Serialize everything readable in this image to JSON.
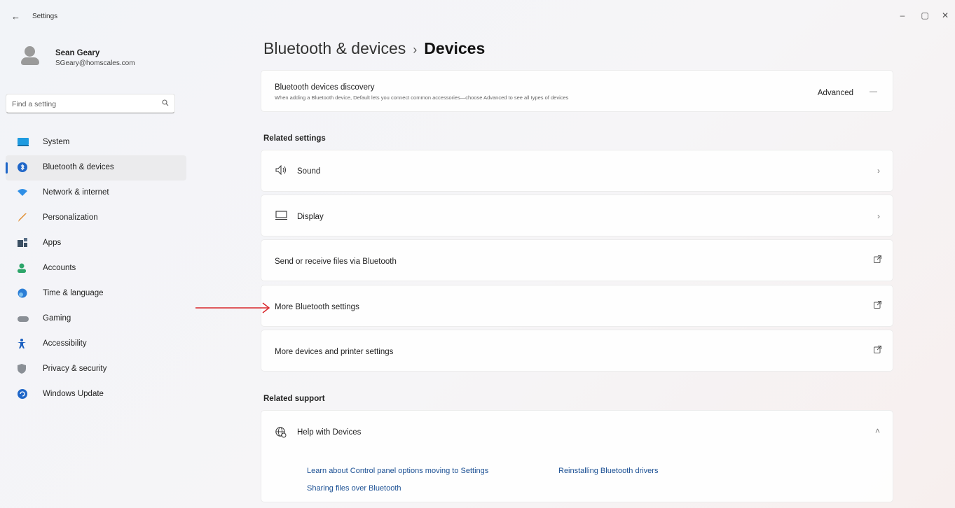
{
  "window": {
    "title": "Settings",
    "back": "←",
    "minimize": "–",
    "maximize": "▢",
    "close": "✕"
  },
  "user": {
    "name": "Sean Geary",
    "email": "SGeary@homscales.com"
  },
  "search": {
    "placeholder": "Find a setting",
    "icon": "search-icon"
  },
  "sidebar": {
    "items": [
      {
        "label": "System",
        "icon": "system-icon",
        "color": "#1f9be0"
      },
      {
        "label": "Bluetooth & devices",
        "icon": "bluetooth-icon",
        "color": "#1f66c8",
        "selected": true
      },
      {
        "label": "Network & internet",
        "icon": "wifi-icon",
        "color": "#2f8fe6"
      },
      {
        "label": "Personalization",
        "icon": "brush-icon",
        "color": "#e08b2c"
      },
      {
        "label": "Apps",
        "icon": "apps-icon",
        "color": "#3b4f63"
      },
      {
        "label": "Accounts",
        "icon": "accounts-icon",
        "color": "#2da56a"
      },
      {
        "label": "Time & language",
        "icon": "globe-clock-icon",
        "color": "#2b7dd6"
      },
      {
        "label": "Gaming",
        "icon": "controller-icon",
        "color": "#8a8f96"
      },
      {
        "label": "Accessibility",
        "icon": "accessibility-icon",
        "color": "#1a5fc0"
      },
      {
        "label": "Privacy & security",
        "icon": "shield-icon",
        "color": "#8a8f96"
      },
      {
        "label": "Windows Update",
        "icon": "update-icon",
        "color": "#1f66c8"
      }
    ]
  },
  "main": {
    "breadcrumb": {
      "parent": "Bluetooth & devices",
      "separator": "›",
      "current": "Devices"
    },
    "discovery": {
      "title": "Bluetooth devices discovery",
      "description": "When adding a Bluetooth device, Default lets you connect common accessories—choose Advanced to see all types of devices",
      "value": "Advanced"
    },
    "related_settings": {
      "title": "Related settings",
      "items": [
        {
          "label": "Sound",
          "icon": "speaker-icon",
          "action": "chevron"
        },
        {
          "label": "Display",
          "icon": "monitor-icon",
          "action": "chevron"
        },
        {
          "label": "Send or receive files via Bluetooth",
          "action": "external"
        },
        {
          "label": "More Bluetooth settings",
          "action": "external"
        },
        {
          "label": "More devices and printer settings",
          "action": "external"
        }
      ]
    },
    "related_support": {
      "title": "Related support",
      "help": {
        "title": "Help with Devices",
        "links": [
          "Learn about Control panel options moving to Settings",
          "Reinstalling Bluetooth drivers",
          "Sharing files over Bluetooth"
        ]
      }
    }
  },
  "annotation": {
    "color": "#d8262b"
  }
}
